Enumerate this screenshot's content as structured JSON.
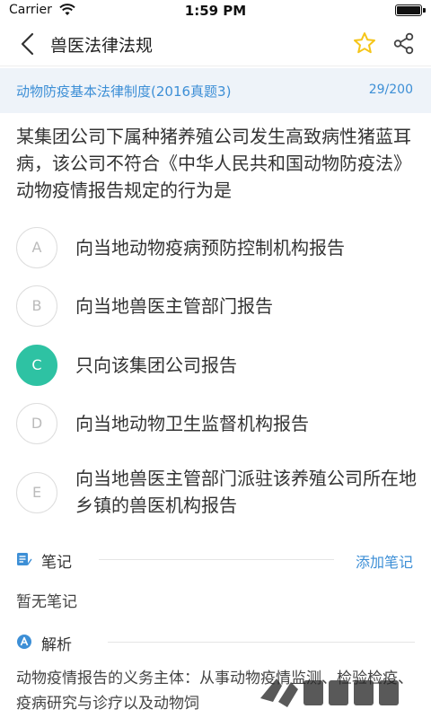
{
  "status_bar": {
    "carrier": "Carrier",
    "time": "1:59 PM"
  },
  "nav": {
    "title": "兽医法律法规",
    "back_icon": "chevron-left-icon",
    "favorite_icon": "star-outline-icon",
    "share_icon": "share-icon"
  },
  "sub_header": {
    "section": "动物防疫基本法律制度(2016真题3)",
    "progress": "29/200"
  },
  "question": {
    "text": "某集团公司下属种猪养殖公司发生高致病性猪蓝耳病，该公司不符合《中华人民共和国动物防疫法》动物疫情报告规定的行为是"
  },
  "options": [
    {
      "letter": "A",
      "text": "向当地动物疫病预防控制机构报告",
      "selected": false
    },
    {
      "letter": "B",
      "text": "向当地兽医主管部门报告",
      "selected": false
    },
    {
      "letter": "C",
      "text": "只向该集团公司报告",
      "selected": true
    },
    {
      "letter": "D",
      "text": "向当地动物卫生监督机构报告",
      "selected": false
    },
    {
      "letter": "E",
      "text": "向当地兽医主管部门派驻该养殖公司所在地乡镇的兽医机构报告",
      "selected": false
    }
  ],
  "notes": {
    "label": "笔记",
    "add_label": "添加笔记",
    "empty_text": "暂无笔记"
  },
  "analysis": {
    "label": "解析",
    "text": "动物疫情报告的义务主体：从事动物疫情监测、检验检疫、疫病研究与诊疗以及动物饲"
  },
  "colors": {
    "accent_blue": "#3d8fd6",
    "selected_green": "#2ec2a3",
    "star_yellow": "#f5c518",
    "sub_header_bg": "#eef3f9"
  }
}
